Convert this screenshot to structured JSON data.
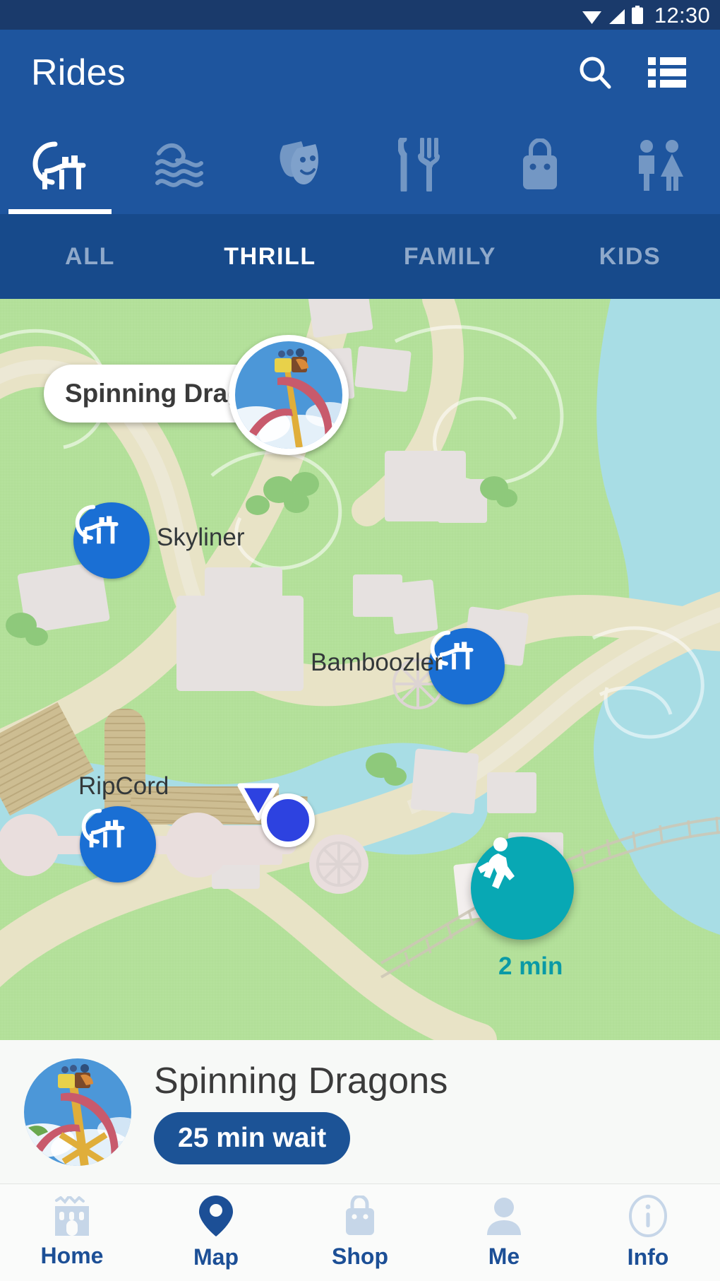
{
  "status_bar": {
    "time": "12:30",
    "icons": [
      "wifi-icon",
      "signal-icon",
      "battery-icon"
    ]
  },
  "app_bar": {
    "title": "Rides",
    "actions": [
      {
        "name": "search-icon",
        "label": "Search"
      },
      {
        "name": "list-view-icon",
        "label": "List"
      }
    ]
  },
  "category_tabs": {
    "active_index": 0,
    "items": [
      {
        "icon": "roller-coaster-icon",
        "label": "Rides",
        "active": true
      },
      {
        "icon": "water-waves-icon",
        "label": "Water",
        "active": false
      },
      {
        "icon": "theater-masks-icon",
        "label": "Shows",
        "active": false
      },
      {
        "icon": "dining-icon",
        "label": "Dining",
        "active": false
      },
      {
        "icon": "shopping-bag-icon",
        "label": "Shops",
        "active": false
      },
      {
        "icon": "restrooms-icon",
        "label": "Restrooms",
        "active": false
      }
    ]
  },
  "filter_tabs": {
    "active": "THRILL",
    "items": [
      "ALL",
      "THRILL",
      "FAMILY",
      "KIDS"
    ]
  },
  "map": {
    "callout": {
      "label": "Spinning Dragons"
    },
    "selected_marker": {
      "name": "spinning-dragons-photo-marker",
      "ride": "Spinning Dragons"
    },
    "markers": [
      {
        "name": "map-marker-skyliner",
        "label": "Skyliner",
        "icon": "roller-coaster-icon"
      },
      {
        "name": "map-marker-bamboozler",
        "label": "Bamboozler",
        "icon": "roller-coaster-icon"
      },
      {
        "name": "map-marker-ripcord",
        "label": "RipCord",
        "icon": "roller-coaster-icon"
      }
    ],
    "user_location": {
      "name": "user-location-dot"
    },
    "walk_fab": {
      "icon": "walking-person-icon",
      "time": "2 min"
    },
    "colors": {
      "land": "#b3e09a",
      "path": "#e8e3c6",
      "water": "#a8dde5",
      "building": "#e6e1e0",
      "marker_blue": "#1a6fd4",
      "teal": "#08a8b4"
    }
  },
  "detail_card": {
    "thumbnail": "spinning-dragons-thumbnail",
    "title": "Spinning Dragons",
    "wait_badge": "25 min wait"
  },
  "bottom_nav": {
    "active": "Map",
    "items": [
      {
        "icon": "castle-icon",
        "label": "Home",
        "active": false
      },
      {
        "icon": "map-pin-icon",
        "label": "Map",
        "active": true
      },
      {
        "icon": "shopping-bag-icon",
        "label": "Shop",
        "active": false
      },
      {
        "icon": "person-icon",
        "label": "Me",
        "active": false
      },
      {
        "icon": "info-circle-icon",
        "label": "Info",
        "active": false
      }
    ]
  }
}
